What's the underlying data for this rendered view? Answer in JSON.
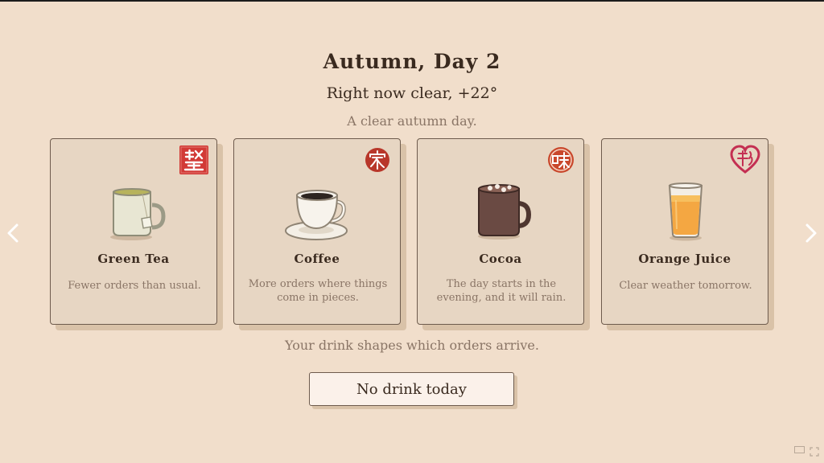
{
  "header": {
    "title": "Autumn, Day 2",
    "weather": "Right now clear, +22°",
    "subtitle": "A clear autumn day."
  },
  "cards": [
    {
      "name": "Green Tea",
      "description": "Fewer orders than usual.",
      "stamp_icon": "seal-stamp-icon",
      "drink_icon": "green-tea-mug-icon",
      "stamp_color": "#d23a36"
    },
    {
      "name": "Coffee",
      "description": "More orders where things come in pieces.",
      "stamp_icon": "house-stamp-icon",
      "drink_icon": "coffee-cup-icon",
      "stamp_color": "#b8372a"
    },
    {
      "name": "Cocoa",
      "description": "The day starts in the evening, and it will rain.",
      "stamp_icon": "taste-stamp-icon",
      "drink_icon": "cocoa-mug-icon",
      "stamp_color": "#c9482c"
    },
    {
      "name": "Orange Juice",
      "description": "Clear weather tomorrow.",
      "stamp_icon": "heart-stamp-icon",
      "drink_icon": "orange-juice-glass-icon",
      "stamp_color": "#c42f52"
    }
  ],
  "hint": "Your drink shapes which orders arrive.",
  "no_drink_label": "No drink today",
  "navigation": {
    "prev_icon": "chevron-left-icon",
    "next_icon": "chevron-right-icon"
  },
  "colors": {
    "background": "#f1decb",
    "card": "#e7d6c3",
    "text": "#3a2a1f",
    "muted_text": "#8a7566"
  }
}
